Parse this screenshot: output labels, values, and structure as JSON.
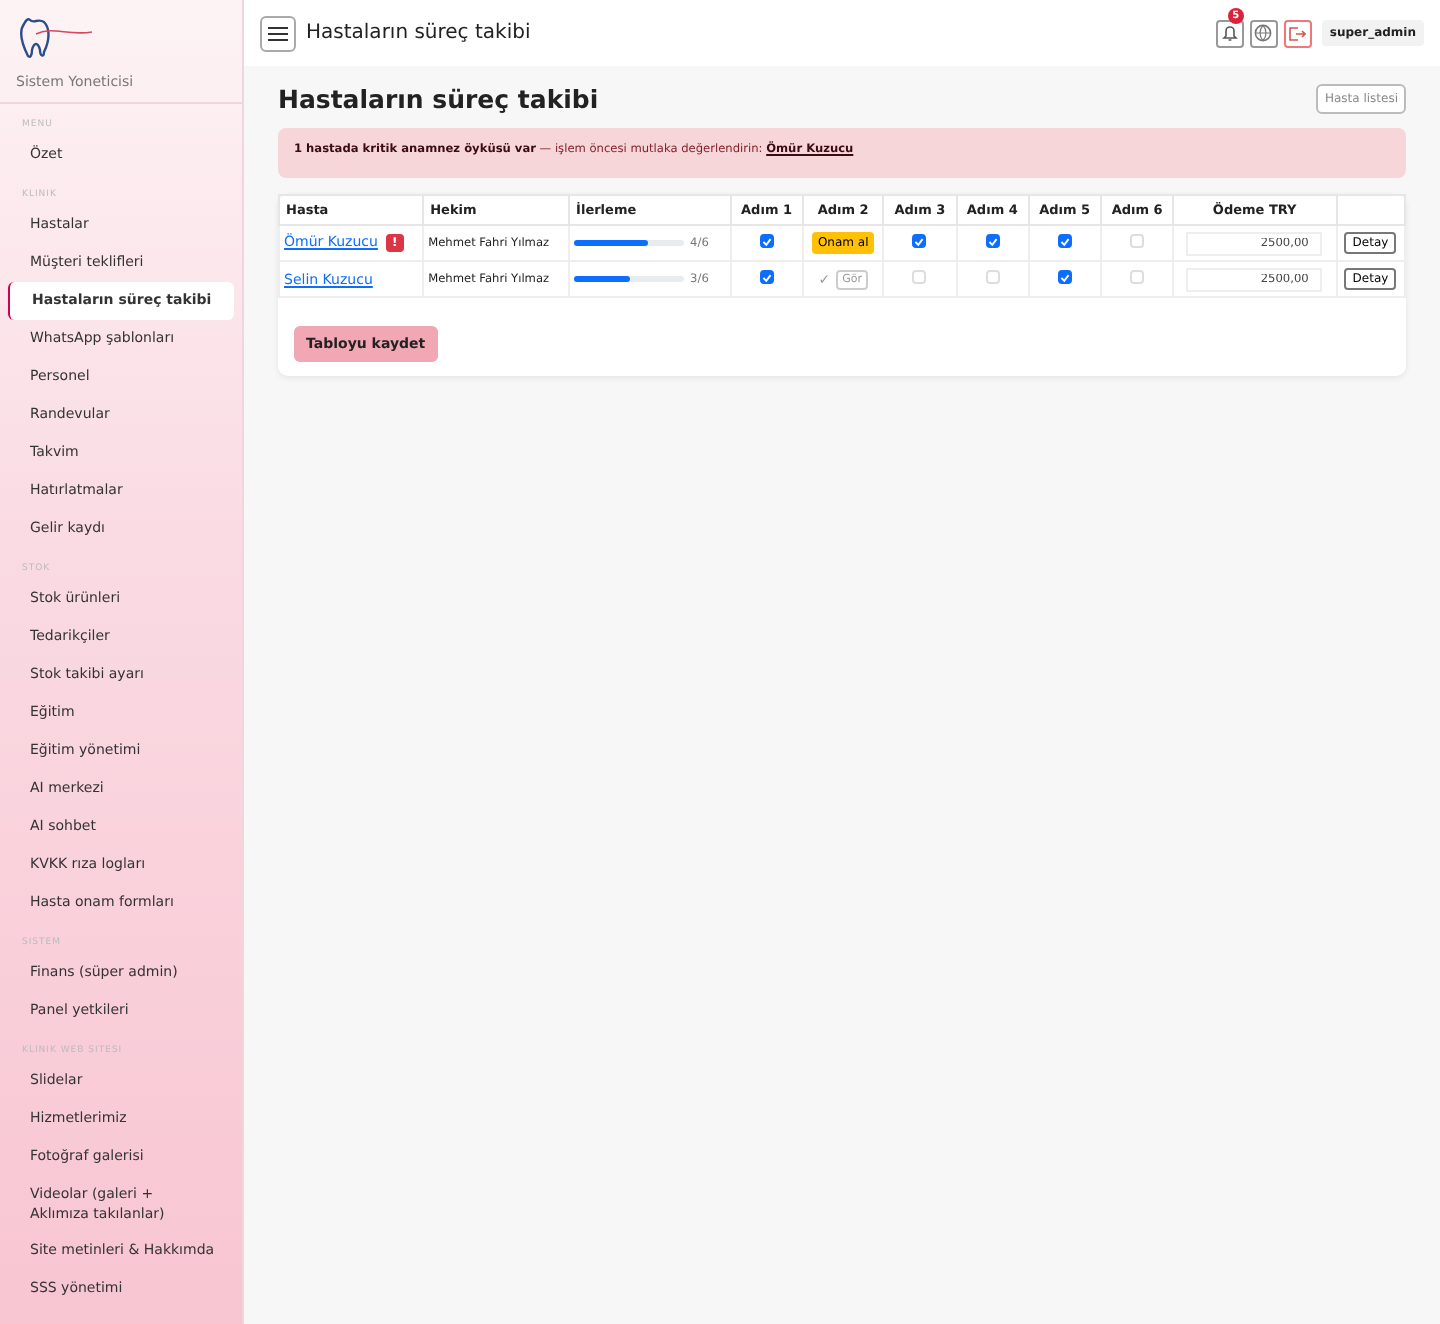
{
  "sidebar": {
    "subtitle": "Sistem Yoneticisi",
    "sections": [
      {
        "heading": "MENU",
        "items": [
          {
            "label": "Özet",
            "selected": false
          }
        ]
      },
      {
        "heading": "KLINIK",
        "items": [
          {
            "label": "Hastalar",
            "selected": false
          },
          {
            "label": "Müşteri teklifleri",
            "selected": false
          },
          {
            "label": "Hastaların süreç takibi",
            "selected": true
          },
          {
            "label": "WhatsApp şablonları",
            "selected": false
          },
          {
            "label": "Personel",
            "selected": false
          },
          {
            "label": "Randevular",
            "selected": false
          },
          {
            "label": "Takvim",
            "selected": false
          },
          {
            "label": "Hatırlatmalar",
            "selected": false
          },
          {
            "label": "Gelir kaydı",
            "selected": false
          }
        ]
      },
      {
        "heading": "STOK",
        "items": [
          {
            "label": "Stok ürünleri",
            "selected": false
          },
          {
            "label": "Tedarikçiler",
            "selected": false
          },
          {
            "label": "Stok takibi ayarı",
            "selected": false
          },
          {
            "label": "Eğitim",
            "selected": false
          },
          {
            "label": "Eğitim yönetimi",
            "selected": false
          },
          {
            "label": "AI merkezi",
            "selected": false
          },
          {
            "label": "AI sohbet",
            "selected": false
          },
          {
            "label": "KVKK rıza logları",
            "selected": false
          },
          {
            "label": "Hasta onam formları",
            "selected": false
          }
        ]
      },
      {
        "heading": "SISTEM",
        "items": [
          {
            "label": "Finans (süper admin)",
            "selected": false
          },
          {
            "label": "Panel yetkileri",
            "selected": false
          }
        ]
      },
      {
        "heading": "KLINIK WEB SITESI",
        "items": [
          {
            "label": "Slidelar",
            "selected": false
          },
          {
            "label": "Hizmetlerimiz",
            "selected": false
          },
          {
            "label": "Fotoğraf galerisi",
            "selected": false
          },
          {
            "label": "Videolar (galeri + Aklımıza takılanlar)",
            "selected": false
          },
          {
            "label": "Site metinleri & Hakkımda",
            "selected": false
          },
          {
            "label": "SSS yönetimi",
            "selected": false
          }
        ]
      }
    ]
  },
  "topbar": {
    "title": "Hastaların süreç takibi",
    "notification_count": "5",
    "user": "super_admin"
  },
  "page": {
    "title": "Hastaların süreç takibi",
    "list_button": "Hasta listesi",
    "alert": {
      "text": "**1 hastada kritik anamnez öyküsü var** — işlem öncesi mutlaka değerlendirin: ",
      "link": "Ömür Kuzucu"
    },
    "table": {
      "columns": [
        "Hasta",
        "Hekim",
        "İlerleme",
        "Adım 1",
        "Adım 2",
        "Adım 3",
        "Adım 4",
        "Adım 5",
        "Adım 6",
        "Ödeme TRY"
      ],
      "rows": [
        {
          "patient": "Ömür Kuzucu",
          "flag": "!",
          "doctor": "Mehmet Fahri Yılmaz",
          "level": 0.667,
          "reading": "4/6",
          "steps": [
            {
              "kind": "checkbox",
              "checked": true
            },
            {
              "kind": "consent",
              "label": "Onam al"
            },
            {
              "kind": "checkbox",
              "checked": true
            },
            {
              "kind": "checkbox",
              "checked": true
            },
            {
              "kind": "checkbox",
              "checked": true
            },
            {
              "kind": "checkbox",
              "checked": false
            }
          ],
          "payment": "2500,00",
          "action": "Detay"
        },
        {
          "patient": "Selin Kuzucu",
          "doctor": "Mehmet Fahri Yılmaz",
          "level": 0.5,
          "reading": "3/6",
          "steps": [
            {
              "kind": "checkbox",
              "checked": true
            },
            {
              "kind": "signed",
              "mark": "✓",
              "label": "Gör"
            },
            {
              "kind": "checkbox",
              "checked": false
            },
            {
              "kind": "checkbox",
              "checked": false
            },
            {
              "kind": "checkbox",
              "checked": true
            },
            {
              "kind": "checkbox",
              "checked": false
            }
          ],
          "payment": "2500,00",
          "action": "Detay"
        }
      ]
    },
    "save_button": "Tabloyu kaydet"
  }
}
